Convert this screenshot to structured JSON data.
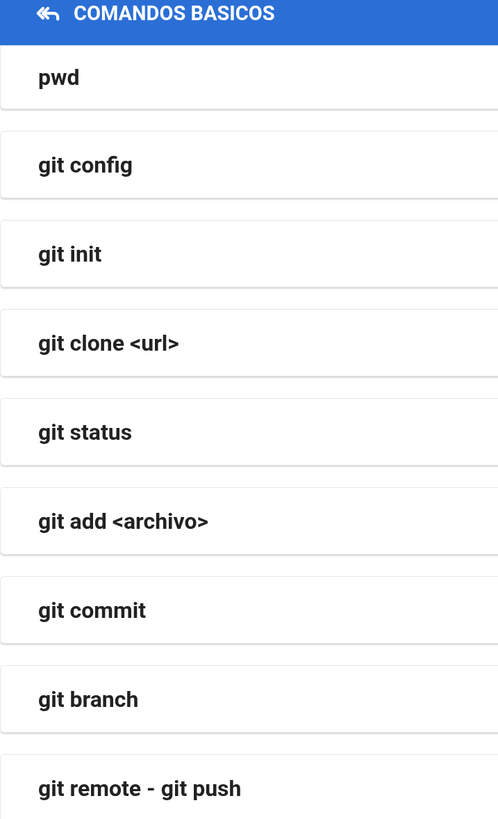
{
  "header": {
    "title": "COMANDOS BASICOS"
  },
  "commands": [
    {
      "label": "pwd"
    },
    {
      "label": "git config"
    },
    {
      "label": "git init"
    },
    {
      "label": "git clone <url>"
    },
    {
      "label": "git status"
    },
    {
      "label": "git add <archivo>"
    },
    {
      "label": "git commit"
    },
    {
      "label": "git branch"
    },
    {
      "label": "git remote - git push"
    }
  ]
}
